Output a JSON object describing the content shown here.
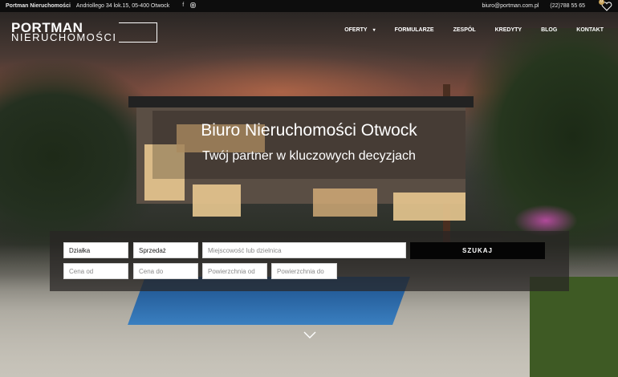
{
  "topbar": {
    "company": "Portman Nieruchomości",
    "address": "Andriollego 34 lok.15,  05-400 Otwock",
    "email": "biuro@portman.com.pl",
    "phone": "(22)788 55 65",
    "facebook_icon": "facebook-icon",
    "instagram_icon": "instagram-icon",
    "favorites_count": "0"
  },
  "logo": {
    "line1": "PORTMAN",
    "line2": "NIERUCHOMOŚCI"
  },
  "nav": {
    "items": [
      {
        "label": "OFERTY"
      },
      {
        "label": "FORMULARZE"
      },
      {
        "label": "ZESPÓŁ"
      },
      {
        "label": "KREDYTY"
      },
      {
        "label": "BLOG"
      },
      {
        "label": "KONTAKT"
      }
    ]
  },
  "hero": {
    "title": "Biuro Nieruchomości Otwock",
    "subtitle": "Twój partner w kluczowych decyzjach"
  },
  "search": {
    "type_value": "Działka",
    "transaction_value": "Sprzedaż",
    "location_placeholder": "Miejscowość lub dzielnica",
    "submit_label": "SZUKAJ",
    "price_from_placeholder": "Cena od",
    "price_to_placeholder": "Cena do",
    "area_from_placeholder": "Powierzchnia od",
    "area_to_placeholder": "Powierzchnia do"
  },
  "colors": {
    "accent": "#c9a35a",
    "topbar_bg": "#0d0d0d",
    "button_bg": "#050505"
  }
}
